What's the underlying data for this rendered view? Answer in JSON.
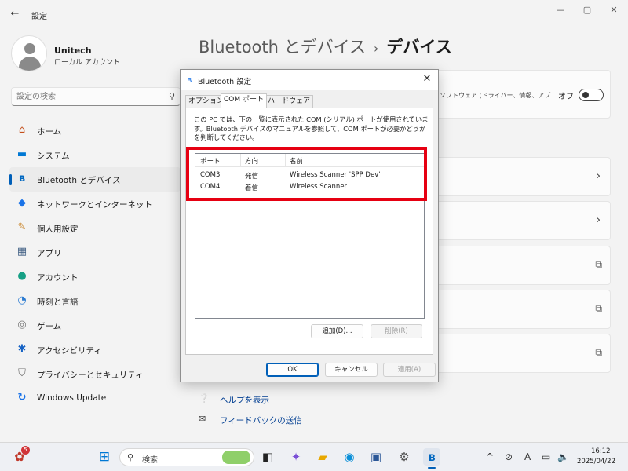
{
  "window": {
    "title": "設定",
    "back_icon": "back-arrow-icon",
    "min_glyph": "—",
    "max_glyph": "▢",
    "close_glyph": "✕"
  },
  "profile": {
    "name": "Unitech",
    "account_type": "ローカル アカウント"
  },
  "search": {
    "placeholder": "設定の検索",
    "icon_glyph": "⚲"
  },
  "sidebar": {
    "items": [
      {
        "label": "ホーム",
        "icon": "home-icon",
        "glyph": "⌂",
        "color": "#c44f1a"
      },
      {
        "label": "システム",
        "icon": "monitor-icon",
        "glyph": "▬",
        "color": "#0078d4"
      },
      {
        "label": "Bluetooth とデバイス",
        "icon": "bluetooth-icon",
        "glyph": "ʙ",
        "color": "#0067c0",
        "selected": true
      },
      {
        "label": "ネットワークとインターネット",
        "icon": "wifi-icon",
        "glyph": "◆",
        "color": "#1a73e8"
      },
      {
        "label": "個人用設定",
        "icon": "brush-icon",
        "glyph": "✎",
        "color": "#c9852a"
      },
      {
        "label": "アプリ",
        "icon": "apps-icon",
        "glyph": "▦",
        "color": "#3a5a80"
      },
      {
        "label": "アカウント",
        "icon": "person-icon",
        "glyph": "●",
        "color": "#16a085"
      },
      {
        "label": "時刻と言語",
        "icon": "globe-clock-icon",
        "glyph": "◔",
        "color": "#2b7bd1"
      },
      {
        "label": "ゲーム",
        "icon": "gamepad-icon",
        "glyph": "◎",
        "color": "#777777"
      },
      {
        "label": "アクセシビリティ",
        "icon": "accessibility-icon",
        "glyph": "✱",
        "color": "#1662c4"
      },
      {
        "label": "プライバシーとセキュリティ",
        "icon": "shield-icon",
        "glyph": "⛉",
        "color": "#707070"
      },
      {
        "label": "Windows Update",
        "icon": "update-icon",
        "glyph": "↻",
        "color": "#1a73e8"
      }
    ]
  },
  "main": {
    "breadcrumb_parent": "Bluetooth とデバイス",
    "breadcrumb_sep": "›",
    "breadcrumb_current": "デバイス",
    "card_text": "ソフトウェア (ドライバー、情報、アプ",
    "toggle_label": "オフ",
    "toggle_on": false,
    "chevron_glyph": "›",
    "ext_glyph": "⧉",
    "help_link": "ヘルプを表示",
    "feedback_link": "フィードバックの送信"
  },
  "dialog": {
    "title": "Bluetooth 設定",
    "close_glyph": "✕",
    "tabs": [
      "オプション",
      "COM ポート",
      "ハードウェア"
    ],
    "active_tab": "COM ポート",
    "description": "この PC では、下の一覧に表示された COM (シリアル) ポートが使用されています。Bluetooth デバイスのマニュアルを参照して、COM ポートが必要かどうかを判断してください。",
    "columns": [
      "ポート",
      "方向",
      "名前"
    ],
    "rows": [
      {
        "port": "COM3",
        "direction": "発信",
        "name": "Wireless Scanner 'SPP Dev'"
      },
      {
        "port": "COM4",
        "direction": "着信",
        "name": "Wireless Scanner"
      }
    ],
    "add_button": "追加(D)...",
    "remove_button": "削除(R)",
    "ok_button": "OK",
    "cancel_button": "キャンセル",
    "apply_button": "適用(A)",
    "highlight_color": "#e60012"
  },
  "taskbar": {
    "notification_count": "5",
    "search_icon_glyph": "⚲",
    "search_label": "検索",
    "time": "16:12",
    "date": "2025/04/22",
    "ime_glyph": "A",
    "tray_chevron": "^",
    "accent": "#005fb8"
  }
}
